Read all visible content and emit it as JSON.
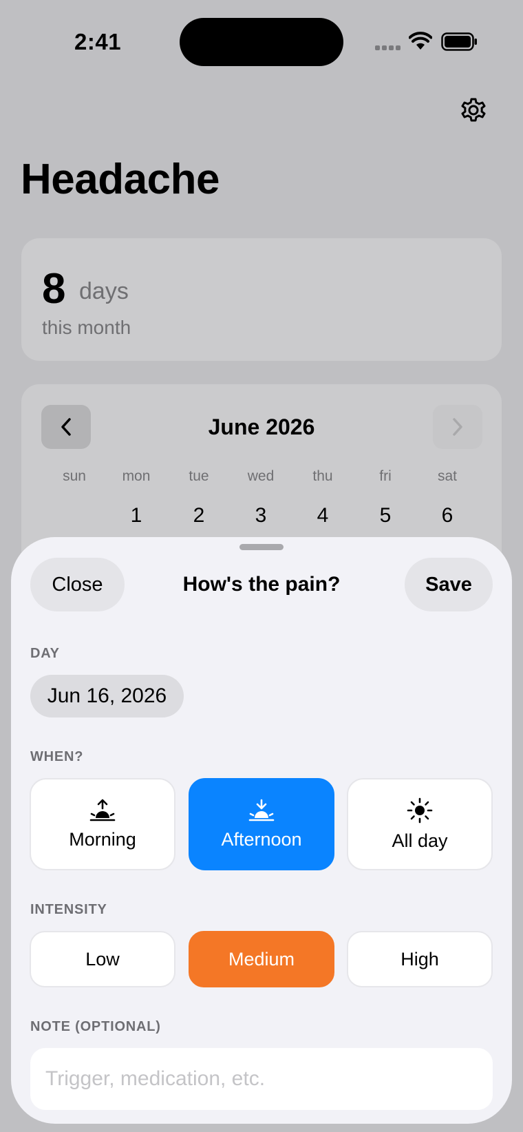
{
  "status_bar": {
    "time": "2:41"
  },
  "header": {
    "title": "Headache"
  },
  "stats": {
    "count": "8",
    "unit": "days",
    "caption": "this month"
  },
  "calendar": {
    "month_label": "June 2026",
    "weekdays": [
      "sun",
      "mon",
      "tue",
      "wed",
      "thu",
      "fri",
      "sat"
    ],
    "first_row": [
      "",
      "1",
      "2",
      "3",
      "4",
      "5",
      "6"
    ]
  },
  "sheet": {
    "close_label": "Close",
    "title": "How's the pain?",
    "save_label": "Save",
    "day_section": "DAY",
    "date_value": "Jun 16, 2026",
    "when_section": "WHEN?",
    "when_options": [
      {
        "label": "Morning",
        "icon": "sunrise-icon",
        "selected": false
      },
      {
        "label": "Afternoon",
        "icon": "sunset-icon",
        "selected": true
      },
      {
        "label": "All day",
        "icon": "sun-icon",
        "selected": false
      }
    ],
    "intensity_section": "INTENSITY",
    "intensity_options": [
      {
        "label": "Low",
        "selected": false
      },
      {
        "label": "Medium",
        "selected": true
      },
      {
        "label": "High",
        "selected": false
      }
    ],
    "note_section": "NOTE (OPTIONAL)",
    "note_placeholder": "Trigger, medication, etc.",
    "note_value": ""
  },
  "colors": {
    "accent_blue": "#0a84ff",
    "medium_orange": "#f47726",
    "sheet_bg": "#f2f2f7",
    "dim_bg": "#bfbfc2"
  }
}
